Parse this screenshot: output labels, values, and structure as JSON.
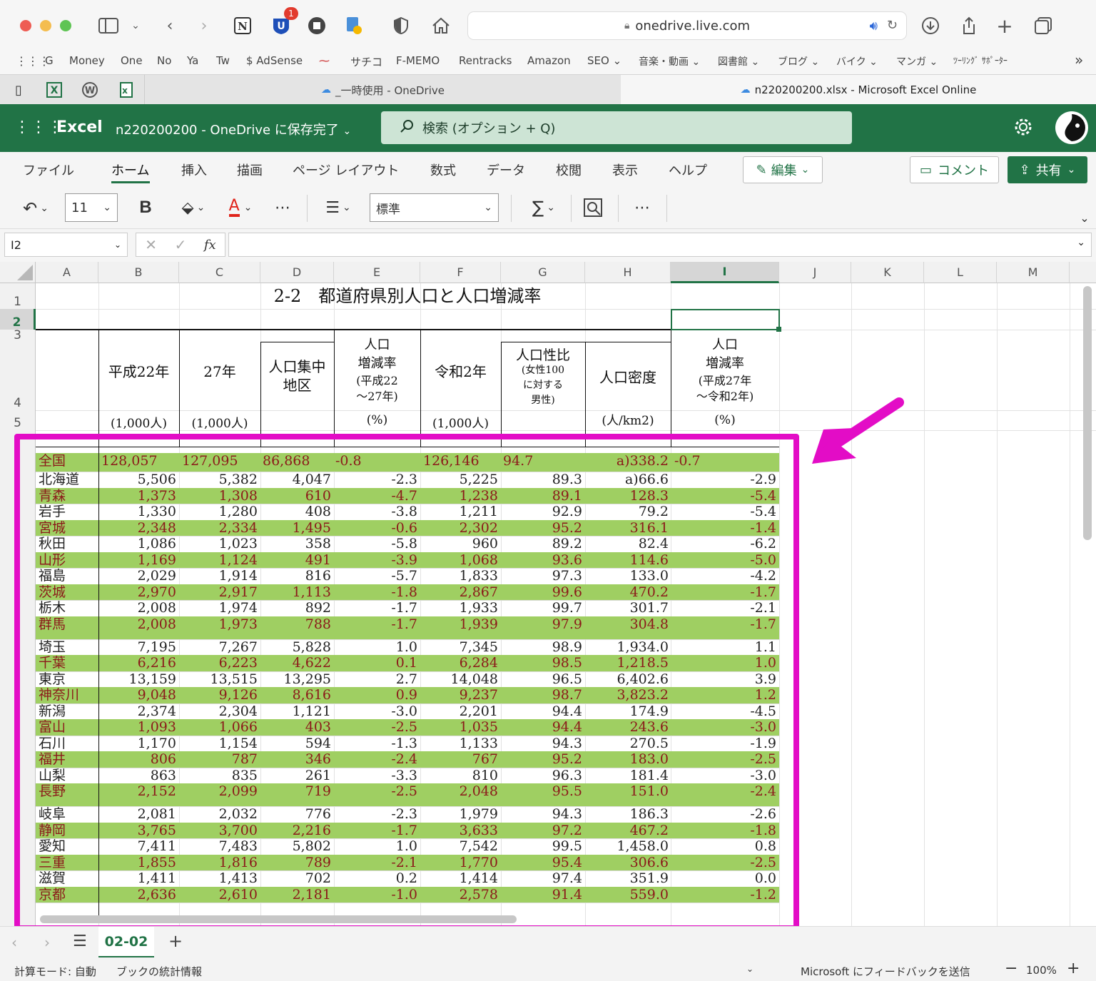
{
  "browser": {
    "url": "onedrive.live.com",
    "badge": "1",
    "bookmarks": [
      "G",
      "Money",
      "One",
      "No",
      "Ya",
      "Tw",
      "$ AdSense",
      "サチコ",
      "F-MEMO",
      "Rentracks",
      "Amazon",
      "SEO ⌄",
      "音楽・動画 ⌄",
      "図書館 ⌄",
      "ブログ ⌄",
      "バイク ⌄",
      "マンガ ⌄",
      "ﾂｰﾘﾝｸﾞ ｻﾎﾟｰﾀｰ"
    ],
    "tabs": [
      "_一時使用 - OneDrive",
      "n220200200.xlsx - Microsoft Excel Online"
    ]
  },
  "excel": {
    "app": "Excel",
    "doc_title": "n220200200  -  OneDrive に保存完了",
    "search_placeholder": "検索 (オプション + Q)",
    "ribbon_tabs": [
      "ファイル",
      "ホーム",
      "挿入",
      "描画",
      "ページ レイアウト",
      "数式",
      "データ",
      "校閲",
      "表示",
      "ヘルプ"
    ],
    "edit_label": "編集",
    "comment_label": "コメント",
    "share_label": "共有",
    "font_size": "11",
    "number_format": "標準",
    "name_box": "I2",
    "fx": "fx"
  },
  "grid": {
    "columns": [
      "A",
      "B",
      "C",
      "D",
      "E",
      "F",
      "G",
      "H",
      "I",
      "J",
      "K",
      "L",
      "M"
    ],
    "row_numbers": [
      "1",
      "2",
      "3",
      "4",
      "5"
    ],
    "title": "2-2　都道府県別人口と人口増減率",
    "headers": {
      "b": "平成22年",
      "c": "27年",
      "d": "人口集中\n地区",
      "e_title": "人口\n増減率",
      "e_sub": "(平成22\n～27年)",
      "f": "令和2年",
      "g_title": "人口性比",
      "g_sub": "(女性100\nに対する\n男性)",
      "h": "人口密度",
      "i_title": "人口\n増減率",
      "i_sub": "(平成27年\n～令和2年)"
    },
    "units": {
      "b": "(1,000人)",
      "c": "(1,000人)",
      "e": "(%)",
      "f": "(1,000人)",
      "h": "(人/km2)",
      "i": "(%)"
    },
    "rows": [
      {
        "name": "全国",
        "v": [
          "128,057",
          "127,095",
          "86,868",
          "-0.8",
          "126,146",
          "94.7",
          "a)338.2",
          "-0.7"
        ],
        "green": true,
        "national": true
      },
      {
        "name": "北海道",
        "v": [
          "5,506",
          "5,382",
          "4,047",
          "-2.3",
          "5,225",
          "89.3",
          "a)66.6",
          "-2.9"
        ],
        "green": false
      },
      {
        "name": "青森",
        "v": [
          "1,373",
          "1,308",
          "610",
          "-4.7",
          "1,238",
          "89.1",
          "128.3",
          "-5.4"
        ],
        "green": true
      },
      {
        "name": "岩手",
        "v": [
          "1,330",
          "1,280",
          "408",
          "-3.8",
          "1,211",
          "92.9",
          "79.2",
          "-5.4"
        ],
        "green": false
      },
      {
        "name": "宮城",
        "v": [
          "2,348",
          "2,334",
          "1,495",
          "-0.6",
          "2,302",
          "95.2",
          "316.1",
          "-1.4"
        ],
        "green": true
      },
      {
        "name": "秋田",
        "v": [
          "1,086",
          "1,023",
          "358",
          "-5.8",
          "960",
          "89.2",
          "82.4",
          "-6.2"
        ],
        "green": false
      },
      {
        "name": "山形",
        "v": [
          "1,169",
          "1,124",
          "491",
          "-3.9",
          "1,068",
          "93.6",
          "114.6",
          "-5.0"
        ],
        "green": true
      },
      {
        "name": "福島",
        "v": [
          "2,029",
          "1,914",
          "816",
          "-5.7",
          "1,833",
          "97.3",
          "133.0",
          "-4.2"
        ],
        "green": false
      },
      {
        "name": "茨城",
        "v": [
          "2,970",
          "2,917",
          "1,113",
          "-1.8",
          "2,867",
          "99.6",
          "470.2",
          "-1.7"
        ],
        "green": true
      },
      {
        "name": "栃木",
        "v": [
          "2,008",
          "1,974",
          "892",
          "-1.7",
          "1,933",
          "99.7",
          "301.7",
          "-2.1"
        ],
        "green": false
      },
      {
        "name": "群馬",
        "v": [
          "2,008",
          "1,973",
          "788",
          "-1.7",
          "1,939",
          "97.9",
          "304.8",
          "-1.7"
        ],
        "green": true,
        "tall": true
      },
      {
        "name": "埼玉",
        "v": [
          "7,195",
          "7,267",
          "5,828",
          "1.0",
          "7,345",
          "98.9",
          "1,934.0",
          "1.1"
        ],
        "green": false
      },
      {
        "name": "千葉",
        "v": [
          "6,216",
          "6,223",
          "4,622",
          "0.1",
          "6,284",
          "98.5",
          "1,218.5",
          "1.0"
        ],
        "green": true
      },
      {
        "name": "東京",
        "v": [
          "13,159",
          "13,515",
          "13,295",
          "2.7",
          "14,048",
          "96.5",
          "6,402.6",
          "3.9"
        ],
        "green": false
      },
      {
        "name": "神奈川",
        "v": [
          "9,048",
          "9,126",
          "8,616",
          "0.9",
          "9,237",
          "98.7",
          "3,823.2",
          "1.2"
        ],
        "green": true
      },
      {
        "name": "新潟",
        "v": [
          "2,374",
          "2,304",
          "1,121",
          "-3.0",
          "2,201",
          "94.4",
          "174.9",
          "-4.5"
        ],
        "green": false
      },
      {
        "name": "富山",
        "v": [
          "1,093",
          "1,066",
          "403",
          "-2.5",
          "1,035",
          "94.4",
          "243.6",
          "-3.0"
        ],
        "green": true
      },
      {
        "name": "石川",
        "v": [
          "1,170",
          "1,154",
          "594",
          "-1.3",
          "1,133",
          "94.3",
          "270.5",
          "-1.9"
        ],
        "green": false
      },
      {
        "name": "福井",
        "v": [
          "806",
          "787",
          "346",
          "-2.4",
          "767",
          "95.2",
          "183.0",
          "-2.5"
        ],
        "green": true
      },
      {
        "name": "山梨",
        "v": [
          "863",
          "835",
          "261",
          "-3.3",
          "810",
          "96.3",
          "181.4",
          "-3.0"
        ],
        "green": false
      },
      {
        "name": "長野",
        "v": [
          "2,152",
          "2,099",
          "719",
          "-2.5",
          "2,048",
          "95.5",
          "151.0",
          "-2.4"
        ],
        "green": true,
        "tall": true
      },
      {
        "name": "岐阜",
        "v": [
          "2,081",
          "2,032",
          "776",
          "-2.3",
          "1,979",
          "94.3",
          "186.3",
          "-2.6"
        ],
        "green": false
      },
      {
        "name": "静岡",
        "v": [
          "3,765",
          "3,700",
          "2,216",
          "-1.7",
          "3,633",
          "97.2",
          "467.2",
          "-1.8"
        ],
        "green": true
      },
      {
        "name": "愛知",
        "v": [
          "7,411",
          "7,483",
          "5,802",
          "1.0",
          "7,542",
          "99.5",
          "1,458.0",
          "0.8"
        ],
        "green": false
      },
      {
        "name": "三重",
        "v": [
          "1,855",
          "1,816",
          "789",
          "-2.1",
          "1,770",
          "95.4",
          "306.6",
          "-2.5"
        ],
        "green": true
      },
      {
        "name": "滋賀",
        "v": [
          "1,411",
          "1,413",
          "702",
          "0.2",
          "1,414",
          "97.4",
          "351.9",
          "0.0"
        ],
        "green": false
      },
      {
        "name": "京都",
        "v": [
          "2,636",
          "2,610",
          "2,181",
          "-1.0",
          "2,578",
          "91.4",
          "559.0",
          "-1.2"
        ],
        "green": true
      }
    ]
  },
  "sheet": {
    "tab": "02-02"
  },
  "status": {
    "calc_mode": "計算モード: 自動",
    "workbook_stats": "ブックの統計情報",
    "feedback": "Microsoft にフィードバックを送信",
    "zoom": "100%"
  },
  "colors": {
    "excel_green": "#217346",
    "row_green": "#9fcf62",
    "row_text": "#8b1a1a",
    "highlight": "#e30cc6"
  }
}
